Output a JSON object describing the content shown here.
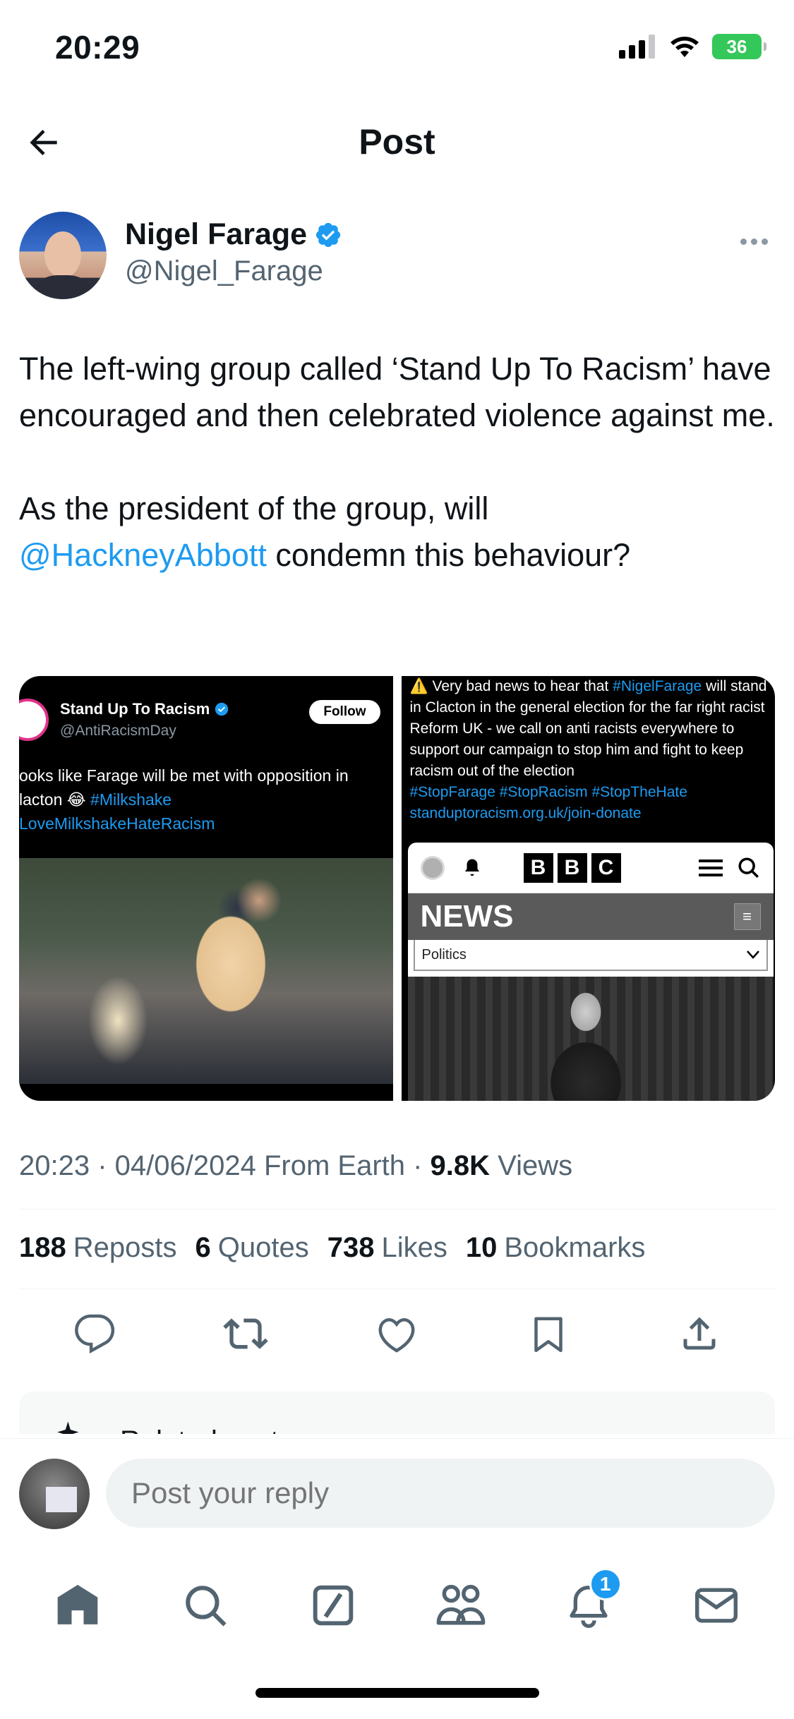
{
  "status_bar": {
    "time": "20:29",
    "battery": "36"
  },
  "header": {
    "title": "Post"
  },
  "author": {
    "name": "Nigel Farage",
    "handle": "@Nigel_Farage"
  },
  "tweet": {
    "para1": "The left-wing group called ‘Stand Up To Racism’ have encouraged and then celebrated violence against me.",
    "para2_before": "As the president of the group, will",
    "mention": "@HackneyAbbott",
    "para2_after": " condemn this behaviour?"
  },
  "media": {
    "left": {
      "account_name": "Stand Up To Racism",
      "account_handle": "@AntiRacismDay",
      "follow_label": "Follow",
      "text_line1": "ooks like Farage will be met with opposition in",
      "text_line2_prefix": "lacton 😂 ",
      "hashtag1": "#Milkshake",
      "hashtag2": "LoveMilkshakeHateRacism"
    },
    "right": {
      "text_prefix": "⚠️ Very bad news to hear that ",
      "hashtag_farage": "#NigelFarage",
      "text_body": " will stand in Clacton in the general election for the far right racist Reform UK - we call on anti racists everywhere to support our campaign to stop him and fight to keep racism out of the election",
      "hashtags": "#StopFarage #StopRacism #StopTheHate",
      "link": "standuptoracism.org.uk/join-donate",
      "bbc_letters": [
        "B",
        "B",
        "C"
      ],
      "bbc_news": "NEWS",
      "bbc_section": "Politics"
    }
  },
  "meta": {
    "time_date": "20:23 · 04/06/2024 From Earth · ",
    "views_count": "9.8K",
    "views_label": " Views"
  },
  "stats": [
    {
      "count": "188",
      "label": "Reposts"
    },
    {
      "count": "6",
      "label": "Quotes"
    },
    {
      "count": "738",
      "label": "Likes"
    },
    {
      "count": "10",
      "label": "Bookmarks"
    }
  ],
  "related": {
    "label": "Related posts"
  },
  "reply": {
    "placeholder": "Post your reply"
  },
  "tab_bar": {
    "notifications_badge": "1"
  },
  "colors": {
    "accent": "#1d9bf0",
    "text": "#0f1419",
    "muted": "#536471"
  }
}
